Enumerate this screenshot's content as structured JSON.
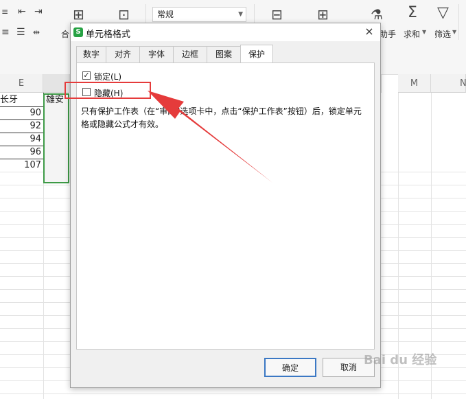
{
  "ribbon": {
    "merge_label": "合",
    "number_format": "常规",
    "helper_label": "助手",
    "sum_label": "求和",
    "filter_label": "筛选",
    "icons": [
      "align-left-icon",
      "indent-icon",
      "justify-icon",
      "wrap-icon",
      "merge-icon",
      "convert-icon",
      "table-style-icon",
      "cell-style-icon",
      "helper-icon",
      "sum-icon",
      "filter-icon"
    ]
  },
  "sheet": {
    "columns": [
      "E",
      "M",
      "N"
    ],
    "header_cell": "长牙",
    "partial_cell": "雄安",
    "values": [
      "90",
      "92",
      "94",
      "96",
      "107"
    ]
  },
  "dialog": {
    "title": "单元格格式",
    "close": "×",
    "tabs": [
      "数字",
      "对齐",
      "字体",
      "边框",
      "图案",
      "保护"
    ],
    "active_tab": "保护",
    "locked": {
      "label": "锁定(L)",
      "checked": true,
      "mark": "✓"
    },
    "hidden": {
      "label": "隐藏(H)",
      "checked": false
    },
    "note": "只有保护工作表（在“审阅”选项卡中，点击“保护工作表”按钮）后，锁定单元格或隐藏公式才有效。",
    "ok_label": "确定",
    "cancel_label": "取消"
  },
  "watermark": "Bai du 经验",
  "colors": {
    "accent_green": "#27a244",
    "highlight_red": "#e53b3b",
    "ok_border": "#3b78c4"
  }
}
